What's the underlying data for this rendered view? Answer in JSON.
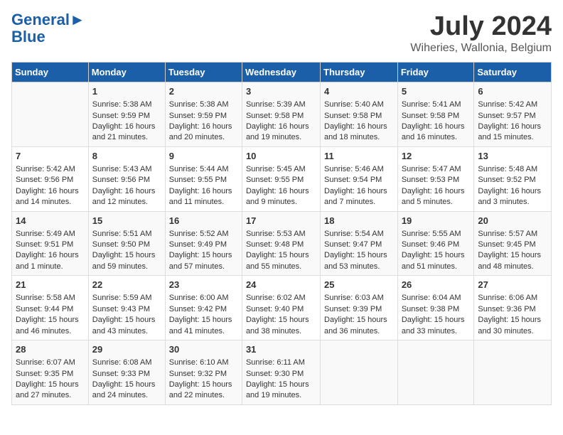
{
  "logo": {
    "line1": "General",
    "line2": "Blue"
  },
  "title": "July 2024",
  "subtitle": "Wiheries, Wallonia, Belgium",
  "days_of_week": [
    "Sunday",
    "Monday",
    "Tuesday",
    "Wednesday",
    "Thursday",
    "Friday",
    "Saturday"
  ],
  "weeks": [
    [
      {
        "day": "",
        "sunrise": "",
        "sunset": "",
        "daylight": ""
      },
      {
        "day": "1",
        "sunrise": "Sunrise: 5:38 AM",
        "sunset": "Sunset: 9:59 PM",
        "daylight": "Daylight: 16 hours and 21 minutes."
      },
      {
        "day": "2",
        "sunrise": "Sunrise: 5:38 AM",
        "sunset": "Sunset: 9:59 PM",
        "daylight": "Daylight: 16 hours and 20 minutes."
      },
      {
        "day": "3",
        "sunrise": "Sunrise: 5:39 AM",
        "sunset": "Sunset: 9:58 PM",
        "daylight": "Daylight: 16 hours and 19 minutes."
      },
      {
        "day": "4",
        "sunrise": "Sunrise: 5:40 AM",
        "sunset": "Sunset: 9:58 PM",
        "daylight": "Daylight: 16 hours and 18 minutes."
      },
      {
        "day": "5",
        "sunrise": "Sunrise: 5:41 AM",
        "sunset": "Sunset: 9:58 PM",
        "daylight": "Daylight: 16 hours and 16 minutes."
      },
      {
        "day": "6",
        "sunrise": "Sunrise: 5:42 AM",
        "sunset": "Sunset: 9:57 PM",
        "daylight": "Daylight: 16 hours and 15 minutes."
      }
    ],
    [
      {
        "day": "7",
        "sunrise": "Sunrise: 5:42 AM",
        "sunset": "Sunset: 9:56 PM",
        "daylight": "Daylight: 16 hours and 14 minutes."
      },
      {
        "day": "8",
        "sunrise": "Sunrise: 5:43 AM",
        "sunset": "Sunset: 9:56 PM",
        "daylight": "Daylight: 16 hours and 12 minutes."
      },
      {
        "day": "9",
        "sunrise": "Sunrise: 5:44 AM",
        "sunset": "Sunset: 9:55 PM",
        "daylight": "Daylight: 16 hours and 11 minutes."
      },
      {
        "day": "10",
        "sunrise": "Sunrise: 5:45 AM",
        "sunset": "Sunset: 9:55 PM",
        "daylight": "Daylight: 16 hours and 9 minutes."
      },
      {
        "day": "11",
        "sunrise": "Sunrise: 5:46 AM",
        "sunset": "Sunset: 9:54 PM",
        "daylight": "Daylight: 16 hours and 7 minutes."
      },
      {
        "day": "12",
        "sunrise": "Sunrise: 5:47 AM",
        "sunset": "Sunset: 9:53 PM",
        "daylight": "Daylight: 16 hours and 5 minutes."
      },
      {
        "day": "13",
        "sunrise": "Sunrise: 5:48 AM",
        "sunset": "Sunset: 9:52 PM",
        "daylight": "Daylight: 16 hours and 3 minutes."
      }
    ],
    [
      {
        "day": "14",
        "sunrise": "Sunrise: 5:49 AM",
        "sunset": "Sunset: 9:51 PM",
        "daylight": "Daylight: 16 hours and 1 minute."
      },
      {
        "day": "15",
        "sunrise": "Sunrise: 5:51 AM",
        "sunset": "Sunset: 9:50 PM",
        "daylight": "Daylight: 15 hours and 59 minutes."
      },
      {
        "day": "16",
        "sunrise": "Sunrise: 5:52 AM",
        "sunset": "Sunset: 9:49 PM",
        "daylight": "Daylight: 15 hours and 57 minutes."
      },
      {
        "day": "17",
        "sunrise": "Sunrise: 5:53 AM",
        "sunset": "Sunset: 9:48 PM",
        "daylight": "Daylight: 15 hours and 55 minutes."
      },
      {
        "day": "18",
        "sunrise": "Sunrise: 5:54 AM",
        "sunset": "Sunset: 9:47 PM",
        "daylight": "Daylight: 15 hours and 53 minutes."
      },
      {
        "day": "19",
        "sunrise": "Sunrise: 5:55 AM",
        "sunset": "Sunset: 9:46 PM",
        "daylight": "Daylight: 15 hours and 51 minutes."
      },
      {
        "day": "20",
        "sunrise": "Sunrise: 5:57 AM",
        "sunset": "Sunset: 9:45 PM",
        "daylight": "Daylight: 15 hours and 48 minutes."
      }
    ],
    [
      {
        "day": "21",
        "sunrise": "Sunrise: 5:58 AM",
        "sunset": "Sunset: 9:44 PM",
        "daylight": "Daylight: 15 hours and 46 minutes."
      },
      {
        "day": "22",
        "sunrise": "Sunrise: 5:59 AM",
        "sunset": "Sunset: 9:43 PM",
        "daylight": "Daylight: 15 hours and 43 minutes."
      },
      {
        "day": "23",
        "sunrise": "Sunrise: 6:00 AM",
        "sunset": "Sunset: 9:42 PM",
        "daylight": "Daylight: 15 hours and 41 minutes."
      },
      {
        "day": "24",
        "sunrise": "Sunrise: 6:02 AM",
        "sunset": "Sunset: 9:40 PM",
        "daylight": "Daylight: 15 hours and 38 minutes."
      },
      {
        "day": "25",
        "sunrise": "Sunrise: 6:03 AM",
        "sunset": "Sunset: 9:39 PM",
        "daylight": "Daylight: 15 hours and 36 minutes."
      },
      {
        "day": "26",
        "sunrise": "Sunrise: 6:04 AM",
        "sunset": "Sunset: 9:38 PM",
        "daylight": "Daylight: 15 hours and 33 minutes."
      },
      {
        "day": "27",
        "sunrise": "Sunrise: 6:06 AM",
        "sunset": "Sunset: 9:36 PM",
        "daylight": "Daylight: 15 hours and 30 minutes."
      }
    ],
    [
      {
        "day": "28",
        "sunrise": "Sunrise: 6:07 AM",
        "sunset": "Sunset: 9:35 PM",
        "daylight": "Daylight: 15 hours and 27 minutes."
      },
      {
        "day": "29",
        "sunrise": "Sunrise: 6:08 AM",
        "sunset": "Sunset: 9:33 PM",
        "daylight": "Daylight: 15 hours and 24 minutes."
      },
      {
        "day": "30",
        "sunrise": "Sunrise: 6:10 AM",
        "sunset": "Sunset: 9:32 PM",
        "daylight": "Daylight: 15 hours and 22 minutes."
      },
      {
        "day": "31",
        "sunrise": "Sunrise: 6:11 AM",
        "sunset": "Sunset: 9:30 PM",
        "daylight": "Daylight: 15 hours and 19 minutes."
      },
      {
        "day": "",
        "sunrise": "",
        "sunset": "",
        "daylight": ""
      },
      {
        "day": "",
        "sunrise": "",
        "sunset": "",
        "daylight": ""
      },
      {
        "day": "",
        "sunrise": "",
        "sunset": "",
        "daylight": ""
      }
    ]
  ]
}
